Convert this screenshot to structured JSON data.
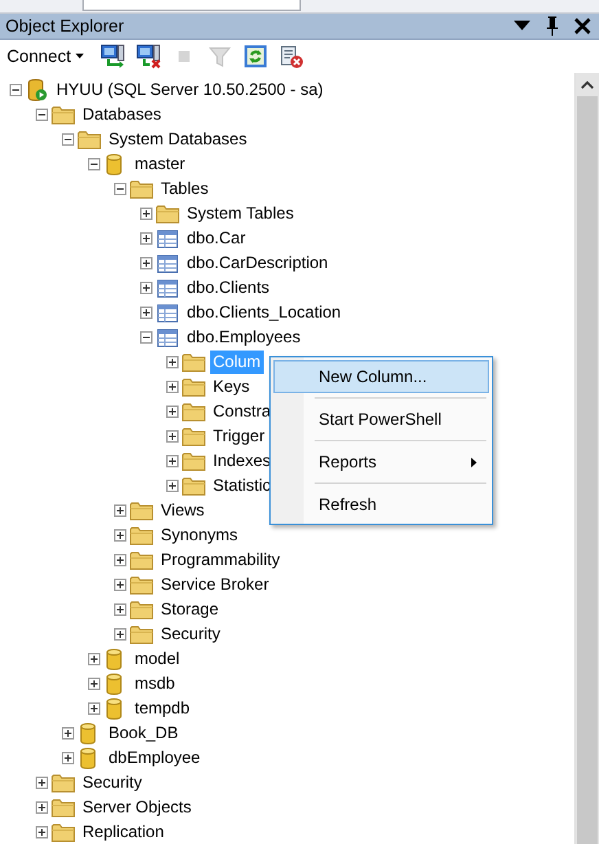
{
  "panel": {
    "title": "Object Explorer"
  },
  "toolbar": {
    "connect": {
      "label": "Connect"
    },
    "buttons": [
      {
        "kind": "connect",
        "disabled": false
      },
      {
        "kind": "disconnect",
        "disabled": false
      },
      {
        "kind": "stop",
        "disabled": true
      },
      {
        "kind": "filter",
        "disabled": true
      },
      {
        "kind": "refresh",
        "disabled": false
      },
      {
        "kind": "script",
        "disabled": false
      }
    ]
  },
  "tree": [
    {
      "label": "HYUU (SQL Server 10.50.2500 - sa)",
      "kind": "server",
      "expanded": true,
      "selected": false,
      "children": [
        {
          "label": "Databases",
          "kind": "folder",
          "expanded": true,
          "selected": false,
          "children": [
            {
              "label": "System Databases",
              "kind": "folder",
              "expanded": true,
              "selected": false,
              "children": [
                {
                  "label": "master",
                  "kind": "database",
                  "expanded": true,
                  "selected": false,
                  "children": [
                    {
                      "label": "Tables",
                      "kind": "folder",
                      "expanded": true,
                      "selected": false,
                      "children": [
                        {
                          "label": "System Tables",
                          "kind": "folder",
                          "expanded": false,
                          "selected": false
                        },
                        {
                          "label": "dbo.Car",
                          "kind": "table",
                          "expanded": false,
                          "selected": false
                        },
                        {
                          "label": "dbo.CarDescription",
                          "kind": "table",
                          "expanded": false,
                          "selected": false
                        },
                        {
                          "label": "dbo.Clients",
                          "kind": "table",
                          "expanded": false,
                          "selected": false
                        },
                        {
                          "label": "dbo.Clients_Location",
                          "kind": "table",
                          "expanded": false,
                          "selected": false
                        },
                        {
                          "label": "dbo.Employees",
                          "kind": "table",
                          "expanded": true,
                          "selected": false,
                          "children": [
                            {
                              "label": "Colum",
                              "kind": "folder",
                              "expanded": false,
                              "selected": true
                            },
                            {
                              "label": "Keys",
                              "kind": "folder",
                              "expanded": false,
                              "selected": false
                            },
                            {
                              "label": "Constra",
                              "kind": "folder",
                              "expanded": false,
                              "selected": false
                            },
                            {
                              "label": "Trigger",
                              "kind": "folder",
                              "expanded": false,
                              "selected": false
                            },
                            {
                              "label": "Indexes",
                              "kind": "folder",
                              "expanded": false,
                              "selected": false
                            },
                            {
                              "label": "Statistic",
                              "kind": "folder",
                              "expanded": false,
                              "selected": false
                            }
                          ]
                        }
                      ]
                    },
                    {
                      "label": "Views",
                      "kind": "folder",
                      "expanded": false,
                      "selected": false
                    },
                    {
                      "label": "Synonyms",
                      "kind": "folder",
                      "expanded": false,
                      "selected": false
                    },
                    {
                      "label": "Programmability",
                      "kind": "folder",
                      "expanded": false,
                      "selected": false
                    },
                    {
                      "label": "Service Broker",
                      "kind": "folder",
                      "expanded": false,
                      "selected": false
                    },
                    {
                      "label": "Storage",
                      "kind": "folder",
                      "expanded": false,
                      "selected": false
                    },
                    {
                      "label": "Security",
                      "kind": "folder",
                      "expanded": false,
                      "selected": false
                    }
                  ]
                },
                {
                  "label": "model",
                  "kind": "database",
                  "expanded": false,
                  "selected": false
                },
                {
                  "label": "msdb",
                  "kind": "database",
                  "expanded": false,
                  "selected": false
                },
                {
                  "label": "tempdb",
                  "kind": "database",
                  "expanded": false,
                  "selected": false
                }
              ]
            },
            {
              "label": "Book_DB",
              "kind": "database",
              "expanded": false,
              "selected": false
            },
            {
              "label": "dbEmployee",
              "kind": "database",
              "expanded": false,
              "selected": false
            }
          ]
        },
        {
          "label": "Security",
          "kind": "folder",
          "expanded": false,
          "selected": false
        },
        {
          "label": "Server Objects",
          "kind": "folder",
          "expanded": false,
          "selected": false
        },
        {
          "label": "Replication",
          "kind": "folder",
          "expanded": false,
          "selected": false
        }
      ]
    }
  ],
  "context_menu": {
    "items": [
      {
        "kind": "item",
        "label": "New Column...",
        "selected": true
      },
      {
        "kind": "separator"
      },
      {
        "kind": "item",
        "label": "Start PowerShell",
        "selected": false
      },
      {
        "kind": "separator"
      },
      {
        "kind": "submenu",
        "label": "Reports",
        "selected": false
      },
      {
        "kind": "separator"
      },
      {
        "kind": "item",
        "label": "Refresh",
        "selected": false
      }
    ]
  }
}
